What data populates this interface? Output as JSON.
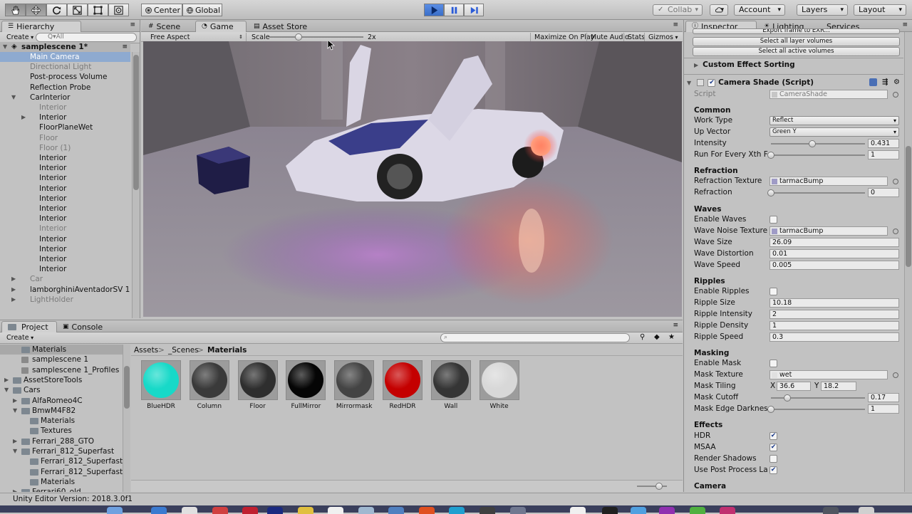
{
  "toolbar": {
    "pivot_label": "Center",
    "space_label": "Global",
    "collab_label": "Collab",
    "account_label": "Account",
    "layers_label": "Layers",
    "layout_label": "Layout"
  },
  "hierarchy": {
    "tab": "Hierarchy",
    "create": "Create",
    "search_placeholder": "Q▾All",
    "scene": "samplescene 1*",
    "items": [
      {
        "label": "Main Camera",
        "selected": true
      },
      {
        "label": "Directional Light"
      },
      {
        "label": "Post-process Volume"
      },
      {
        "label": "Reflection Probe"
      },
      {
        "label": "CarInterior"
      },
      {
        "label": "Interior"
      },
      {
        "label": "Interior"
      },
      {
        "label": "FloorPlaneWet"
      },
      {
        "label": "Floor"
      },
      {
        "label": "Floor (1)"
      },
      {
        "label": "Interior"
      },
      {
        "label": "Interior"
      },
      {
        "label": "Interior"
      },
      {
        "label": "Interior"
      },
      {
        "label": "Interior"
      },
      {
        "label": "Interior"
      },
      {
        "label": "Interior"
      },
      {
        "label": "Interior"
      },
      {
        "label": "Interior"
      },
      {
        "label": "Interior"
      },
      {
        "label": "Interior"
      },
      {
        "label": "Interior"
      },
      {
        "label": "Car"
      },
      {
        "label": "lamborghiniAventadorSV 1"
      },
      {
        "label": "LightHolder"
      }
    ]
  },
  "scene_tabs": {
    "scene": "Scene",
    "game": "Game",
    "asset_store": "Asset Store"
  },
  "game_toolbar": {
    "aspect": "Free Aspect",
    "scale_label": "Scale",
    "scale_value": "2x",
    "maximize": "Maximize On Play",
    "mute": "Mute Audio",
    "stats": "Stats",
    "gizmos": "Gizmos"
  },
  "project": {
    "tab": "Project",
    "console_tab": "Console",
    "create": "Create",
    "breadcrumb": [
      "Assets",
      "_Scenes",
      "Materials"
    ],
    "tree": [
      {
        "label": "Materials",
        "selected": true
      },
      {
        "label": "samplescene 1"
      },
      {
        "label": "samplescene 1_Profiles"
      },
      {
        "label": "AssetStoreTools"
      },
      {
        "label": "Cars"
      },
      {
        "label": "AlfaRomeo4C"
      },
      {
        "label": "BmwM4F82"
      },
      {
        "label": "Materials"
      },
      {
        "label": "Textures"
      },
      {
        "label": "Ferrari_288_GTO"
      },
      {
        "label": "Ferrari_812_Superfast"
      },
      {
        "label": "Ferrari_812_Superfast"
      },
      {
        "label": "Ferrari_812_Superfast"
      },
      {
        "label": "Materials"
      },
      {
        "label": "Ferrari60_old"
      }
    ],
    "assets": [
      {
        "name": "BlueHDR",
        "color": "#17d9c8"
      },
      {
        "name": "Column",
        "color": "#3a3a3a"
      },
      {
        "name": "Floor",
        "color": "#2e2e2e"
      },
      {
        "name": "FullMirror",
        "color": "#050505"
      },
      {
        "name": "Mirrormask",
        "color": "#444444"
      },
      {
        "name": "RedHDR",
        "color": "#c40000"
      },
      {
        "name": "Wall",
        "color": "#353535"
      },
      {
        "name": "White",
        "color": "#d8d8d8"
      }
    ]
  },
  "inspector": {
    "tab": "Inspector",
    "lighting_tab": "Lighting",
    "services_tab": "Services",
    "export_frame": "Export frame to EXR...",
    "select_layer_volumes": "Select all layer volumes",
    "select_active_volumes": "Select all active volumes",
    "custom_effect_sorting": "Custom Effect Sorting",
    "component_title": "Camera Shade (Script)",
    "script_label": "Script",
    "script_value": "CameraShade",
    "common": "Common",
    "work_type_label": "Work Type",
    "work_type_value": "Reflect",
    "up_vector_label": "Up Vector",
    "up_vector_value": "Green Y",
    "intensity_label": "Intensity",
    "intensity_value": "0.431",
    "intensity_level": 0.431,
    "run_label": "Run For Every Xth Frame",
    "run_value": "1",
    "run_level": 0.0,
    "refraction_hdr": "Refraction",
    "refraction_texture_label": "Refraction Texture",
    "refraction_texture_value": "tarmacBump",
    "refraction_label": "Refraction",
    "refraction_value": "0",
    "refraction_level": 0.0,
    "waves_hdr": "Waves",
    "enable_waves_label": "Enable Waves",
    "wave_noise_label": "Wave Noise Texture",
    "wave_noise_value": "tarmacBump",
    "wave_size_label": "Wave Size",
    "wave_size_value": "26.09",
    "wave_distortion_label": "Wave Distortion",
    "wave_distortion_value": "0.01",
    "wave_speed_label": "Wave Speed",
    "wave_speed_value": "0.005",
    "ripples_hdr": "Ripples",
    "enable_ripples_label": "Enable Ripples",
    "ripple_size_label": "Ripple Size",
    "ripple_size_value": "10.18",
    "ripple_intensity_label": "Ripple Intensity",
    "ripple_intensity_value": "2",
    "ripple_density_label": "Ripple Density",
    "ripple_density_value": "1",
    "ripple_speed_label": "Ripple Speed",
    "ripple_speed_value": "0.3",
    "masking_hdr": "Masking",
    "enable_mask_label": "Enable Mask",
    "mask_texture_label": "Mask Texture",
    "mask_texture_value": "wet",
    "mask_tiling_label": "Mask Tiling",
    "mask_tiling_x_label": "X",
    "mask_tiling_x": "36.6",
    "mask_tiling_y_label": "Y",
    "mask_tiling_y": "18.2",
    "mask_cutoff_label": "Mask Cutoff",
    "mask_cutoff_value": "0.17",
    "mask_cutoff_level": 0.17,
    "mask_edge_label": "Mask Edge Darkness",
    "mask_edge_value": "1",
    "mask_edge_level": 0.0,
    "effects_hdr": "Effects",
    "hdr_label": "HDR",
    "msaa_label": "MSAA",
    "render_shadows_label": "Render Shadows",
    "post_process_label": "Use Post Process Layer",
    "camera_hdr": "Camera"
  },
  "status": {
    "version": "Unity Editor Version: 2018.3.0f1"
  },
  "colors": {
    "accent": "#3a6ec8",
    "selection": "#8eaad0",
    "panel": "#c2c2c2"
  }
}
